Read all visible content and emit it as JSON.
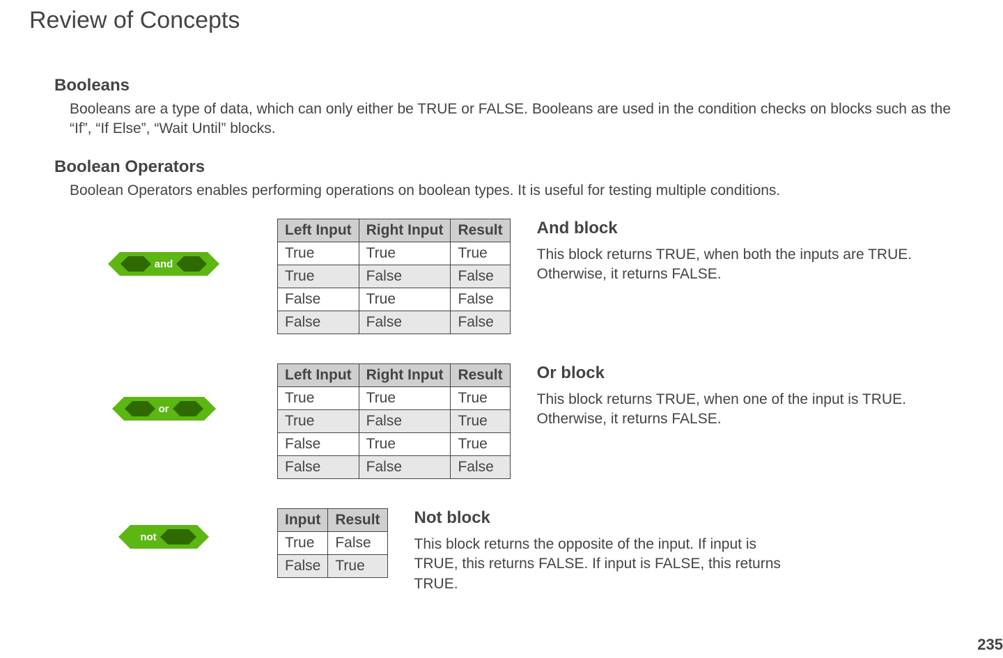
{
  "page": {
    "title": "Review of Concepts",
    "number": "235"
  },
  "sections": {
    "booleans": {
      "heading": "Booleans",
      "body": "Booleans are a type of data, which can only either be TRUE or FALSE. Booleans are used in the condition checks on blocks such as the “If”, “If Else”, “Wait Until” blocks."
    },
    "boolean_operators": {
      "heading": "Boolean Operators",
      "body": "Boolean Operators enables performing operations on boolean types. It is useful for testing multiple conditions."
    }
  },
  "blocks": {
    "and": {
      "label": "and",
      "heading": "And block",
      "body": "This block returns TRUE, when both the inputs are TRUE. Otherwise, it returns FALSE.",
      "table": {
        "headers": [
          "Left Input",
          "Right Input",
          "Result"
        ],
        "rows": [
          [
            "True",
            "True",
            "True"
          ],
          [
            "True",
            "False",
            "False"
          ],
          [
            "False",
            "True",
            "False"
          ],
          [
            "False",
            "False",
            "False"
          ]
        ]
      }
    },
    "or": {
      "label": "or",
      "heading": "Or block",
      "body": "This block returns TRUE, when one of the input is TRUE. Otherwise, it returns FALSE.",
      "table": {
        "headers": [
          "Left Input",
          "Right Input",
          "Result"
        ],
        "rows": [
          [
            "True",
            "True",
            "True"
          ],
          [
            "True",
            "False",
            "True"
          ],
          [
            "False",
            "True",
            "True"
          ],
          [
            "False",
            "False",
            "False"
          ]
        ]
      }
    },
    "not": {
      "label": "not",
      "heading": "Not block",
      "body": "This block returns the opposite of the input. If input is TRUE, this returns FALSE. If input is FALSE, this returns TRUE.",
      "table": {
        "headers": [
          "Input",
          "Result"
        ],
        "rows": [
          [
            "True",
            "False"
          ],
          [
            "False",
            "True"
          ]
        ]
      }
    }
  },
  "chart_data": [
    {
      "type": "table",
      "title": "And block truth table",
      "columns": [
        "Left Input",
        "Right Input",
        "Result"
      ],
      "rows": [
        [
          "True",
          "True",
          "True"
        ],
        [
          "True",
          "False",
          "False"
        ],
        [
          "False",
          "True",
          "False"
        ],
        [
          "False",
          "False",
          "False"
        ]
      ]
    },
    {
      "type": "table",
      "title": "Or block truth table",
      "columns": [
        "Left Input",
        "Right Input",
        "Result"
      ],
      "rows": [
        [
          "True",
          "True",
          "True"
        ],
        [
          "True",
          "False",
          "True"
        ],
        [
          "False",
          "True",
          "True"
        ],
        [
          "False",
          "False",
          "False"
        ]
      ]
    },
    {
      "type": "table",
      "title": "Not block truth table",
      "columns": [
        "Input",
        "Result"
      ],
      "rows": [
        [
          "True",
          "False"
        ],
        [
          "False",
          "True"
        ]
      ]
    }
  ]
}
